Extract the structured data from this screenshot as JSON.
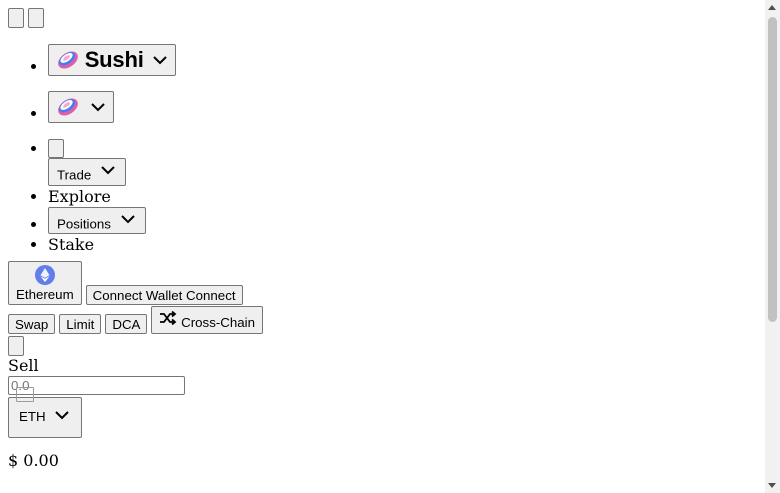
{
  "header": {
    "brand_label": "Sushi",
    "nav": {
      "trade_label": "Trade",
      "explore_label": "Explore",
      "positions_label": "Positions",
      "stake_label": "Stake"
    }
  },
  "network": {
    "label": "Ethereum"
  },
  "wallet": {
    "connect_label": "Connect Wallet Connect"
  },
  "tabs": [
    {
      "label": "Swap"
    },
    {
      "label": "Limit"
    },
    {
      "label": "DCA"
    },
    {
      "label": "Cross-Chain"
    }
  ],
  "sell": {
    "label": "Sell",
    "amount_placeholder": "0.0",
    "token_symbol": "ETH",
    "usd_value": "$ 0.00"
  },
  "icons": {
    "brand": "sushi-logo-icon",
    "chevron": "chevron-down-icon",
    "network": "ethereum-icon",
    "crosschain": "shuffle-icon"
  },
  "colors": {
    "ethereum_blue": "#627EEA",
    "sushi_pink": "#E05DAA",
    "sushi_blue": "#3B7EF8"
  }
}
